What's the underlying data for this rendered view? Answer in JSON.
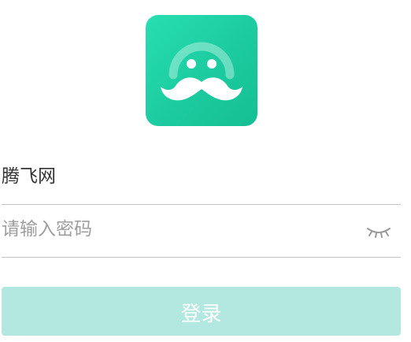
{
  "app": {
    "logo_icon": "mustache-face-logo",
    "logo_color": "#1fd4a6"
  },
  "login_form": {
    "username_value": "腾飞网",
    "password_placeholder": "请输入密码",
    "password_toggle_icon": "eye-closed-icon",
    "login_label": "登录",
    "login_button_color": "#b3e8e0"
  }
}
